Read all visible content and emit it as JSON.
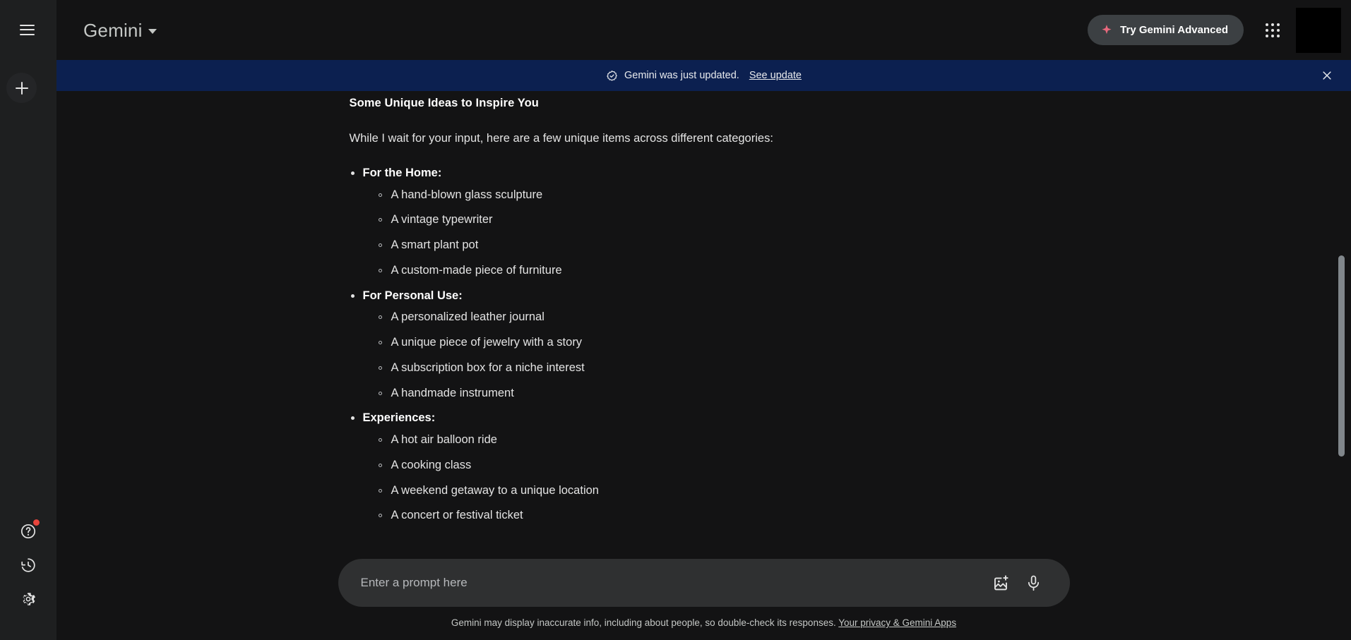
{
  "app": {
    "title": "Gemini",
    "background_color": "#131314",
    "rail_color": "#1e1f20"
  },
  "rail": {
    "menu_icon": "hamburger-menu-icon",
    "new_chat_icon": "plus-icon",
    "bottom_items": [
      {
        "icon": "help-question-icon",
        "has_notification_dot": true,
        "dot_color": "#e8453c"
      },
      {
        "icon": "activity-history-icon",
        "has_notification_dot": false
      },
      {
        "icon": "settings-gear-icon",
        "has_notification_dot": false
      }
    ]
  },
  "topbar": {
    "brand_label": "Gemini",
    "brand_caret_icon": "chevron-down-icon",
    "advanced_button": {
      "label": "Try Gemini Advanced",
      "icon": "sparkle-icon",
      "icon_color": "#e8697d",
      "background": "#3c4043"
    },
    "apps_icon": "google-apps-grid-icon",
    "avatar_icon": "user-avatar"
  },
  "banner": {
    "icon": "new-release-badge-icon",
    "text": "Gemini was just updated.",
    "link_label": "See update",
    "close_icon": "close-icon",
    "background": "#0c2050"
  },
  "conversation": {
    "heading": "Some Unique Ideas to Inspire You",
    "intro": "While I wait for your input, here are a few unique items across different categories:",
    "groups": [
      {
        "title": "For the Home:",
        "items": [
          "A hand-blown glass sculpture",
          "A vintage typewriter",
          "A smart plant pot",
          "A custom-made piece of furniture"
        ]
      },
      {
        "title": "For Personal Use:",
        "items": [
          "A personalized leather journal",
          "A unique piece of jewelry with a story",
          "A subscription box for a niche interest",
          "A handmade instrument"
        ]
      },
      {
        "title": "Experiences:",
        "items": [
          "A hot air balloon ride",
          "A cooking class",
          "A weekend getaway to a unique location",
          "A concert or festival ticket"
        ]
      }
    ]
  },
  "composer": {
    "placeholder": "Enter a prompt here",
    "value": "",
    "image_icon": "add-image-icon",
    "mic_icon": "microphone-icon"
  },
  "footer": {
    "disclaimer": "Gemini may display inaccurate info, including about people, so double-check its responses.",
    "link_label": "Your privacy & Gemini Apps"
  }
}
